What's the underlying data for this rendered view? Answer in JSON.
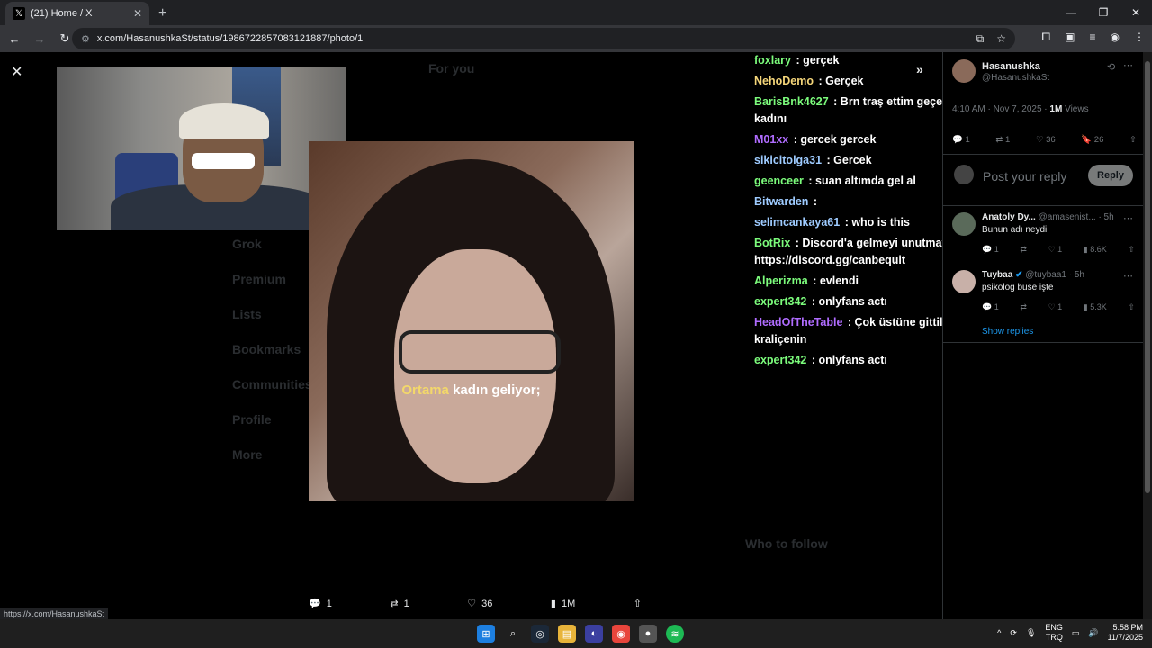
{
  "browser": {
    "tab_title": "(21) Home / X",
    "tab_close": "✕",
    "new_tab": "+",
    "url": "x.com/HasanushkaSt/status/1986722857083121887/photo/1",
    "status_url": "https://x.com/HasanushkaSt"
  },
  "media": {
    "caption_highlight": "Ortama",
    "caption_rest": " kadın geliyor;"
  },
  "actions": {
    "replies": "1",
    "reposts": "1",
    "likes": "36",
    "views": "1M"
  },
  "chat": [
    {
      "user": "foxlary",
      "text": " : gerçek",
      "color": "#7cfc7c"
    },
    {
      "user": "NehoDemo",
      "text": " : Gerçek",
      "color": "#f5d67a"
    },
    {
      "user": "BarisBnk4627",
      "text": " : Brn traş ettim geçen bu kadını",
      "color": "#7cfc7c"
    },
    {
      "user": "M01xx",
      "text": " : gercek gercek",
      "color": "#b06cff"
    },
    {
      "user": "sikicitolga31",
      "text": " : Gercek",
      "color": "#9ecbff"
    },
    {
      "user": "geenceer",
      "text": " : suan altımda gel al",
      "color": "#7cfc7c"
    },
    {
      "user": "Bitwarden",
      "text": " : ",
      "color": "#9ecbff"
    },
    {
      "user": "selimcankaya61",
      "text": " : who is this",
      "color": "#9ecbff"
    },
    {
      "user": "BotRix",
      "text": " : Discord'a gelmeyi unutmayınız https://discord.gg/canbequit",
      "color": "#7cfc7c"
    },
    {
      "user": "Alperizma",
      "text": " : evlendi",
      "color": "#7cfc7c"
    },
    {
      "user": "expert342",
      "text": " : onlyfans actı",
      "color": "#7cfc7c"
    },
    {
      "user": "HeadOfTheTable",
      "text": " : Çok üstüne gittiler kraliçenin",
      "color": "#b06cff"
    },
    {
      "user": "expert342",
      "text": " : onlyfans actı",
      "color": "#7cfc7c"
    }
  ],
  "panel": {
    "name": "Hasanushka",
    "handle": "@HasanushkaSt",
    "meta_time": "4:10 AM · Nov 7, 2025 · ",
    "meta_views": "1M",
    "meta_views_label": " Views",
    "stats": {
      "replies": "1",
      "reposts": "1",
      "likes": "36",
      "bookmarks": "26"
    },
    "reply_placeholder": "Post your reply",
    "reply_button": "Reply",
    "replies": [
      {
        "name": "Anatoly Dy...",
        "handle": " @amasenist... · 5h",
        "text": "Bunun adı neydi",
        "c": "1",
        "l": "1",
        "v": "8.6K"
      },
      {
        "name": "Tuybaa",
        "handle": " @tuybaa1 · 5h",
        "text": "psikolog buse işte",
        "c": "1",
        "l": "1",
        "v": "5.3K"
      }
    ],
    "show_replies": "Show replies"
  },
  "taskbar": {
    "lang1": "ENG",
    "lang2": "TRQ",
    "time": "5:58 PM",
    "date": "11/7/2025"
  }
}
